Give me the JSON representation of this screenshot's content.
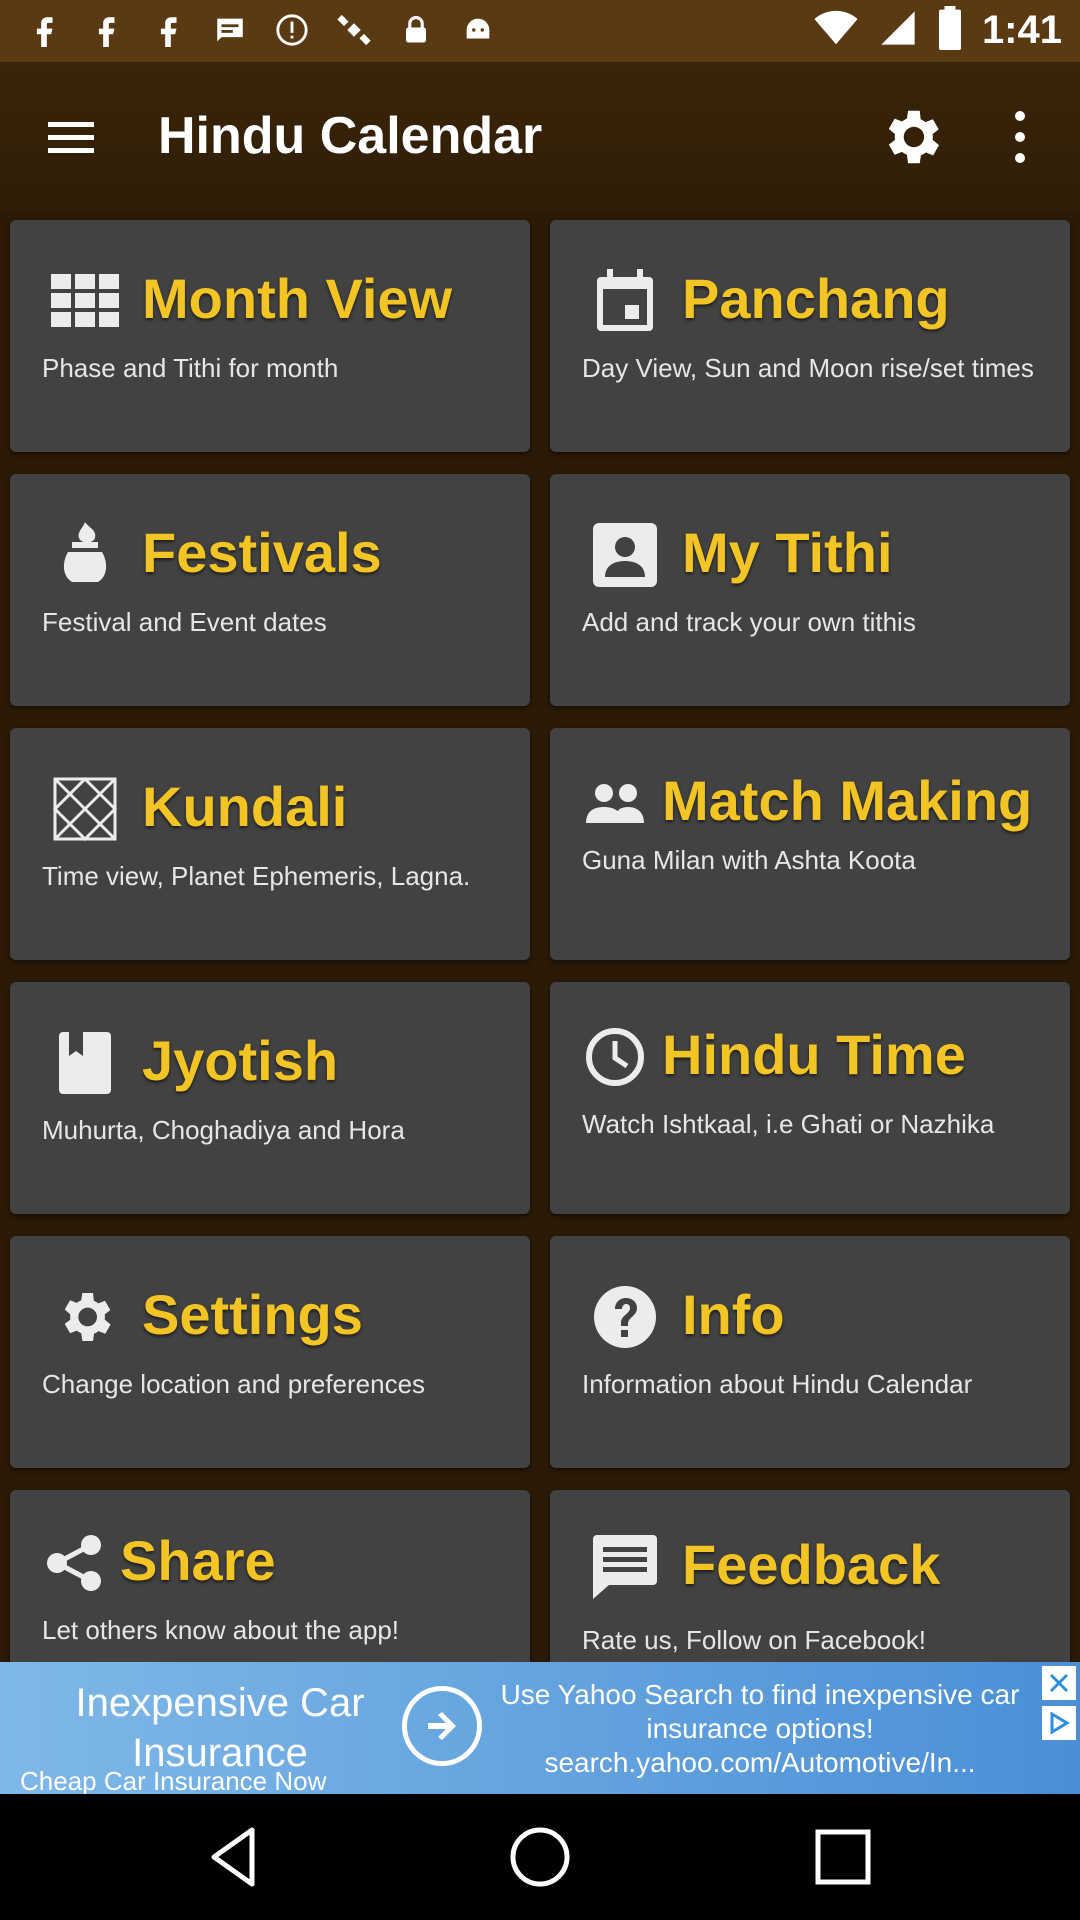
{
  "status_bar": {
    "time": "1:41",
    "left_icons": [
      "facebook-icon",
      "facebook-icon",
      "facebook-icon",
      "message-icon",
      "alert-icon",
      "satellite-icon",
      "lock-icon",
      "android-icon"
    ],
    "right_icons": [
      "wifi-icon",
      "signal-icon",
      "battery-icon"
    ]
  },
  "app_bar": {
    "title": "Hindu Calendar"
  },
  "cards": [
    {
      "title": "Month View",
      "desc": "Phase and Tithi for month",
      "icon": "grid-icon"
    },
    {
      "title": "Panchang",
      "desc": "Day View, Sun and Moon rise/set times",
      "icon": "calendar-icon"
    },
    {
      "title": "Festivals",
      "desc": "Festival and Event dates",
      "icon": "kalash-icon"
    },
    {
      "title": "My Tithi",
      "desc": "Add and track your own tithis",
      "icon": "person-icon"
    },
    {
      "title": "Kundali",
      "desc": "Time view, Planet Ephemeris, Lagna.",
      "icon": "kundali-chart-icon"
    },
    {
      "title": "Match Making",
      "desc": "Guna Milan with Ashta Koota",
      "icon": "people-icon"
    },
    {
      "title": "Jyotish",
      "desc": "Muhurta, Choghadiya and Hora",
      "icon": "book-icon"
    },
    {
      "title": "Hindu Time",
      "desc": "Watch Ishtkaal, i.e Ghati or Nazhika",
      "icon": "clock-icon"
    },
    {
      "title": "Settings",
      "desc": "Change location and preferences",
      "icon": "gear-icon"
    },
    {
      "title": "Info",
      "desc": "Information about Hindu Calendar",
      "icon": "help-icon"
    },
    {
      "title": "Share",
      "desc": "Let others know about the app!",
      "icon": "share-icon"
    },
    {
      "title": "Feedback",
      "desc": "Rate us, Follow on Facebook!",
      "icon": "feedback-icon"
    }
  ],
  "ad": {
    "headline": "Inexpensive Car Insurance",
    "subline": "Cheap Car Insurance Now",
    "body": "Use Yahoo Search to find inexpensive car insurance options! search.yahoo.com/Automotive/In..."
  },
  "colors": {
    "accent": "#f2c524",
    "card": "#424242",
    "background": "#2a1a07"
  }
}
